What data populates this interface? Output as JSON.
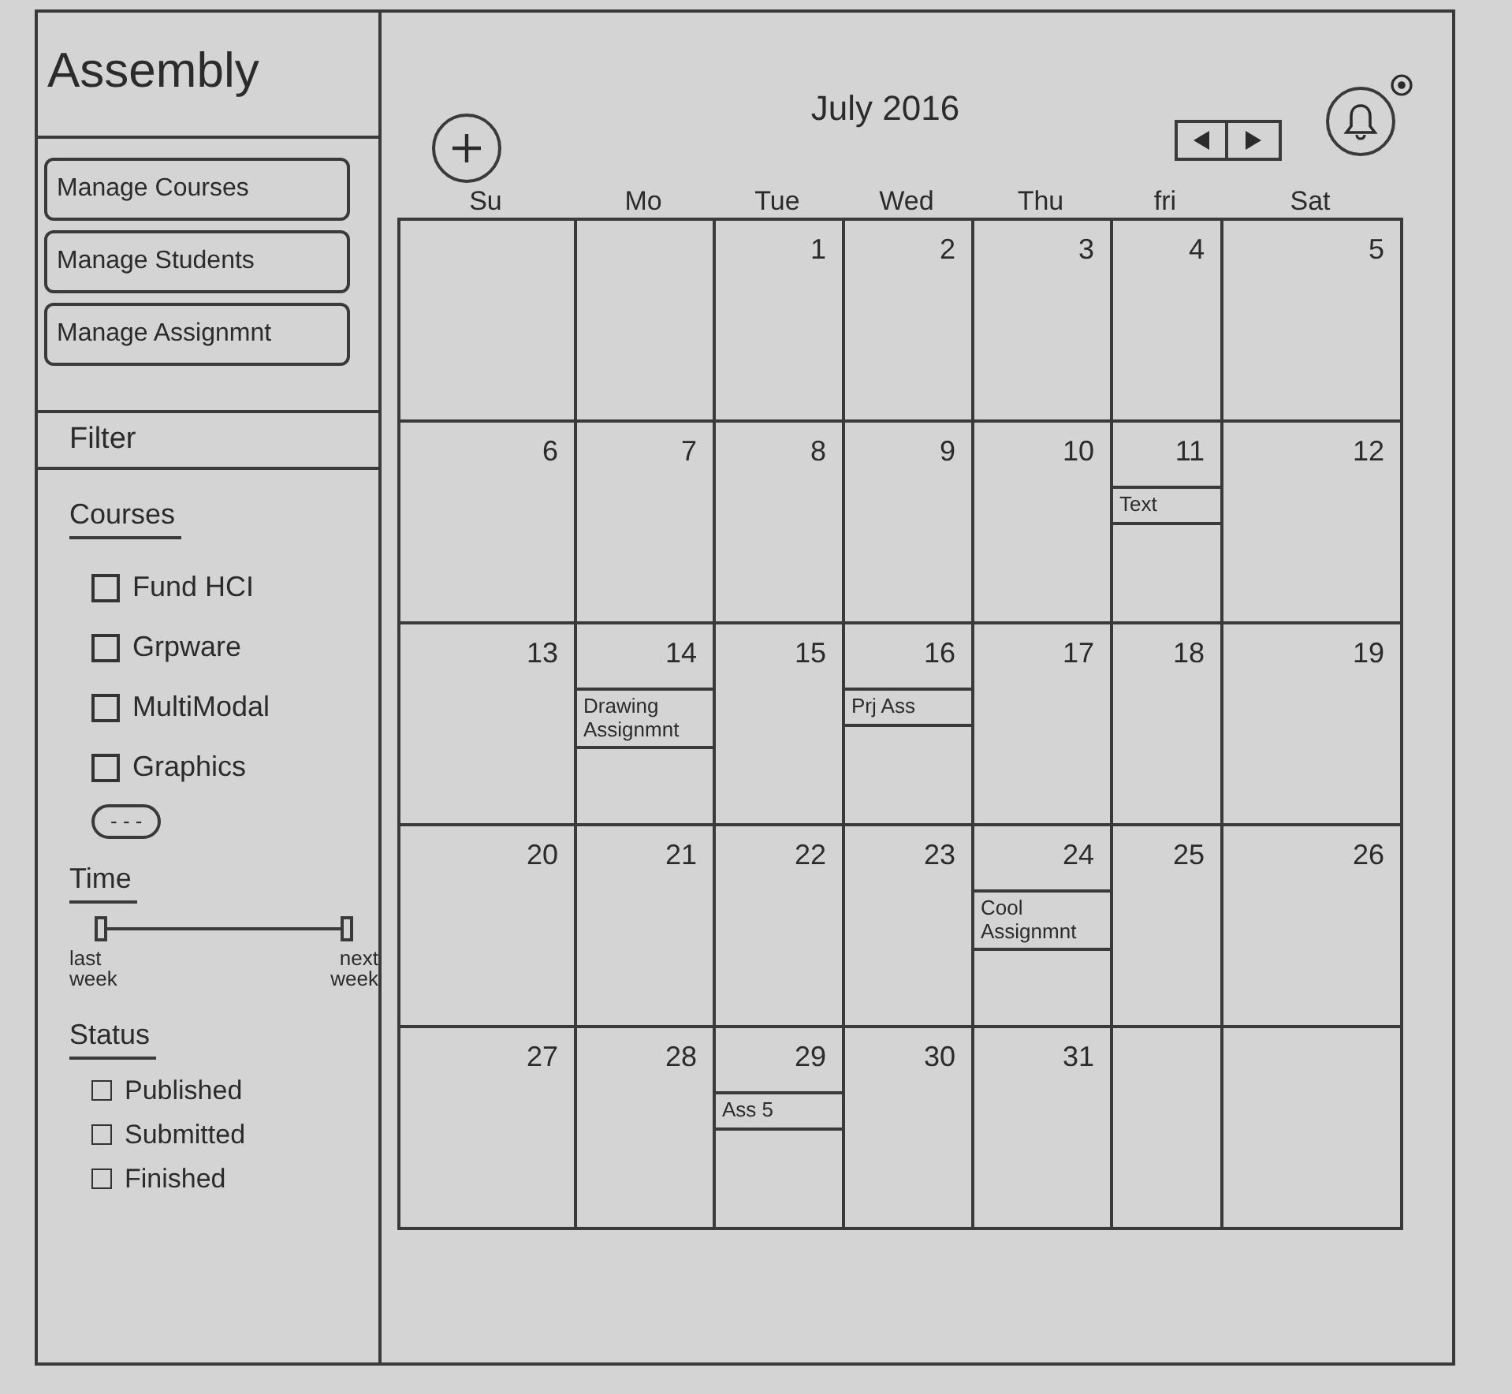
{
  "sidebar": {
    "logo": "Assembly",
    "menu": [
      "Manage Courses",
      "Manage Students",
      "Manage Assignmnt"
    ],
    "filter": {
      "title": "Filter",
      "courses": {
        "title": "Courses",
        "items": [
          {
            "label": "Fund HCI",
            "checked": false
          },
          {
            "label": "Grpware",
            "checked": false
          },
          {
            "label": "MultiModal",
            "checked": false
          },
          {
            "label": "Graphics",
            "checked": false
          }
        ],
        "more": "- - -"
      },
      "time": {
        "title": "Time",
        "handles": [
          {
            "level": 0
          },
          {
            "level": 1
          }
        ],
        "start_label": "last week",
        "end_label": "next week"
      },
      "status": {
        "title": "Status",
        "items": [
          {
            "label": "Published",
            "checked": false
          },
          {
            "label": "Submitted",
            "checked": false
          },
          {
            "label": "Finished",
            "checked": false
          }
        ]
      }
    }
  },
  "calendar": {
    "title": "July 2016",
    "weekdays": [
      "Su",
      "Mo",
      "Tue",
      "Wed",
      "Thu",
      "fri",
      "Sat"
    ],
    "weeks": [
      [
        {
          "day": "1"
        },
        {
          "day": "2"
        },
        {
          "day": "3"
        },
        {
          "day": "4"
        },
        {
          "day": "5"
        }
      ],
      [
        {
          "day": "6"
        },
        {
          "day": "7"
        },
        {
          "day": "8"
        },
        {
          "day": "9"
        },
        {
          "day": "10"
        },
        {
          "day": "11",
          "events": [
            {
              "title": "Text"
            }
          ]
        },
        {
          "day": "12"
        }
      ],
      [
        {
          "day": "13"
        },
        {
          "day": "14",
          "events": [
            {
              "title": "Drawing Assignmnt"
            }
          ]
        },
        {
          "day": "15"
        },
        {
          "day": "16",
          "events": [
            {
              "title": "Prj Ass"
            }
          ]
        },
        {
          "day": "17"
        },
        {
          "day": "18"
        },
        {
          "day": "19"
        }
      ],
      [
        {
          "day": "20"
        },
        {
          "day": "21"
        },
        {
          "day": "22"
        },
        {
          "day": "23"
        },
        {
          "day": "24",
          "events": [
            {
              "title": "Cool Assignmnt"
            }
          ]
        },
        {
          "day": "25"
        },
        {
          "day": "26"
        }
      ],
      [
        {
          "day": "27"
        },
        {
          "day": "28"
        },
        {
          "day": "29",
          "events": [
            {
              "title": "Ass 5"
            }
          ]
        },
        {
          "day": "30"
        },
        {
          "day": "31"
        }
      ]
    ]
  }
}
